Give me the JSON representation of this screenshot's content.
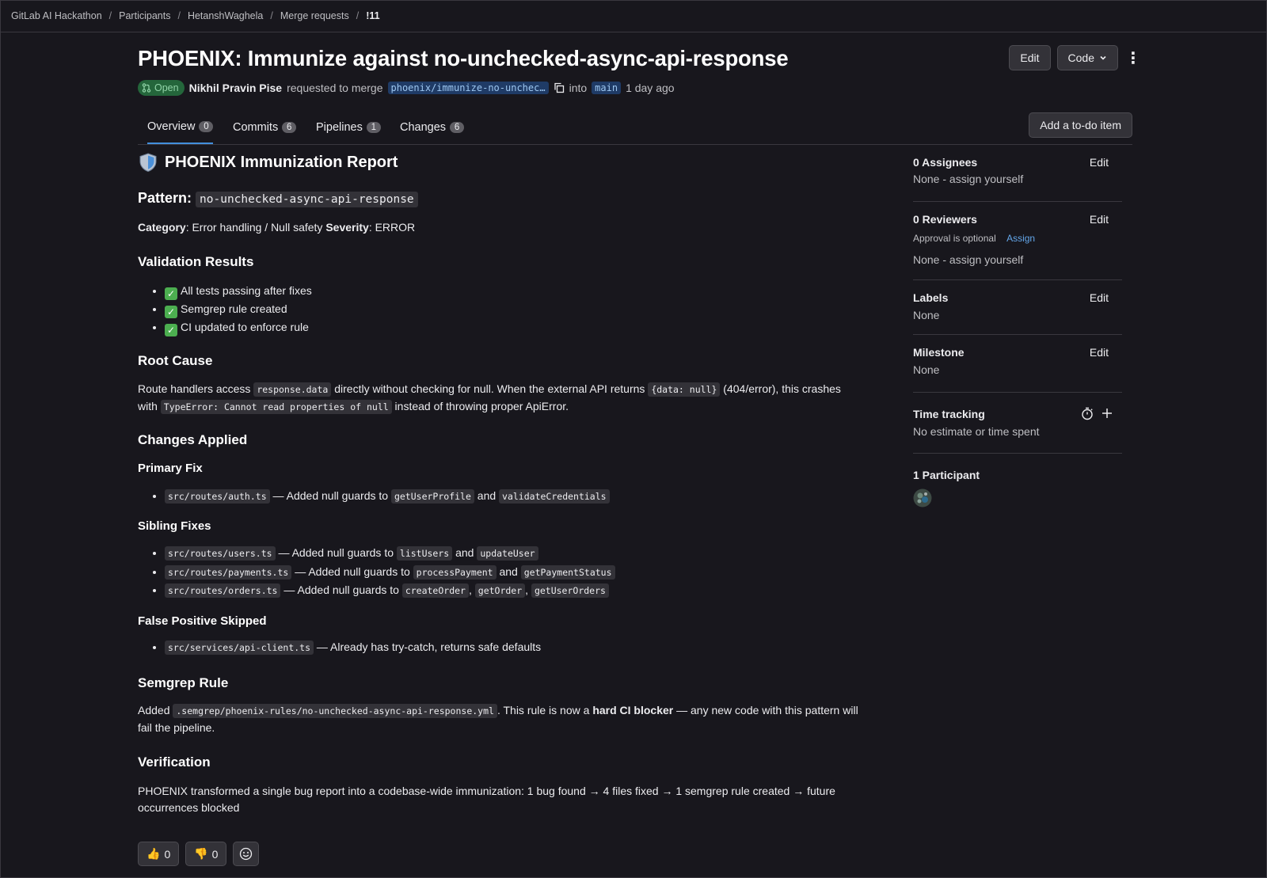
{
  "breadcrumb": [
    "GitLab AI Hackathon",
    "Participants",
    "HetanshWaghela",
    "Merge requests",
    "!11"
  ],
  "title": "PHOENIX: Immunize against no-unchecked-async-api-response",
  "header_buttons": {
    "edit": "Edit",
    "code": "Code"
  },
  "meta": {
    "status": "Open",
    "author": "Nikhil Pravin Pise",
    "requested_text": "requested to merge",
    "source_branch": "phoenix/immunize-no-unchec…",
    "into_text": "into",
    "target_branch": "main",
    "time": "1 day ago"
  },
  "tabs": [
    {
      "label": "Overview",
      "count": "0"
    },
    {
      "label": "Commits",
      "count": "6"
    },
    {
      "label": "Pipelines",
      "count": "1"
    },
    {
      "label": "Changes",
      "count": "6"
    }
  ],
  "todo_button": "Add a to-do item",
  "report": {
    "heading_icon": "shield-emoji",
    "heading": "PHOENIX Immunization Report",
    "pattern_label": "Pattern:",
    "pattern_code": "no-unchecked-async-api-response",
    "category_label": "Category",
    "category_value": ": Error handling / Null safety ",
    "severity_label": "Severity",
    "severity_value": ": ERROR",
    "validation_heading": "Validation Results",
    "validation_items": [
      "All tests passing after fixes",
      "Semgrep rule created",
      "CI updated to enforce rule"
    ],
    "root_cause_heading": "Root Cause",
    "root_cause": {
      "t1": "Route handlers access ",
      "c1": "response.data",
      "t2": " directly without checking for null. When the external API returns ",
      "c2": "{data: null}",
      "t3": " (404/error), this crashes with ",
      "c3": "TypeError: Cannot read properties of null",
      "t4": " instead of throwing proper ApiError."
    },
    "changes_heading": "Changes Applied",
    "primary_heading": "Primary Fix",
    "primary": {
      "file": "src/routes/auth.ts",
      "text": " — Added null guards to ",
      "f1": "getUserProfile",
      "and": " and ",
      "f2": "validateCredentials"
    },
    "sibling_heading": "Sibling Fixes",
    "sibling": [
      {
        "file": "src/routes/users.ts",
        "text": " — Added null guards to ",
        "f1": "listUsers",
        "sep": " and ",
        "f2": "updateUser",
        "sep2": "",
        "f3": ""
      },
      {
        "file": "src/routes/payments.ts",
        "text": " — Added null guards to ",
        "f1": "processPayment",
        "sep": " and ",
        "f2": "getPaymentStatus",
        "sep2": "",
        "f3": ""
      },
      {
        "file": "src/routes/orders.ts",
        "text": " — Added null guards to ",
        "f1": "createOrder",
        "sep": ", ",
        "f2": "getOrder",
        "sep2": ", ",
        "f3": "getUserOrders"
      }
    ],
    "fp_heading": "False Positive Skipped",
    "fp": {
      "file": "src/services/api-client.ts",
      "text": " — Already has try-catch, returns safe defaults"
    },
    "semgrep_heading": "Semgrep Rule",
    "semgrep": {
      "t1": "Added ",
      "c1": ".semgrep/phoenix-rules/no-unchecked-async-api-response.yml",
      "t2": ". This rule is now a ",
      "b1": "hard CI blocker",
      "t3": " — any new code with this pattern will fail the pipeline."
    },
    "verification_heading": "Verification",
    "verification": "PHOENIX transformed a single bug report into a codebase-wide immunization: 1 bug found → 4 files fixed → 1 semgrep rule created → future occurrences blocked"
  },
  "reactions": [
    {
      "emoji": "👍",
      "count": "0"
    },
    {
      "emoji": "👎",
      "count": "0"
    }
  ],
  "sidebar": {
    "assignees": {
      "title": "0 Assignees",
      "edit": "Edit",
      "value": "None - assign yourself"
    },
    "reviewers": {
      "title": "0 Reviewers",
      "edit": "Edit",
      "approval": "Approval is optional",
      "assign": "Assign",
      "value": "None - assign yourself"
    },
    "labels": {
      "title": "Labels",
      "edit": "Edit",
      "value": "None"
    },
    "milestone": {
      "title": "Milestone",
      "edit": "Edit",
      "value": "None"
    },
    "time_tracking": {
      "title": "Time tracking",
      "value": "No estimate or time spent"
    },
    "participants": {
      "title": "1 Participant"
    }
  }
}
